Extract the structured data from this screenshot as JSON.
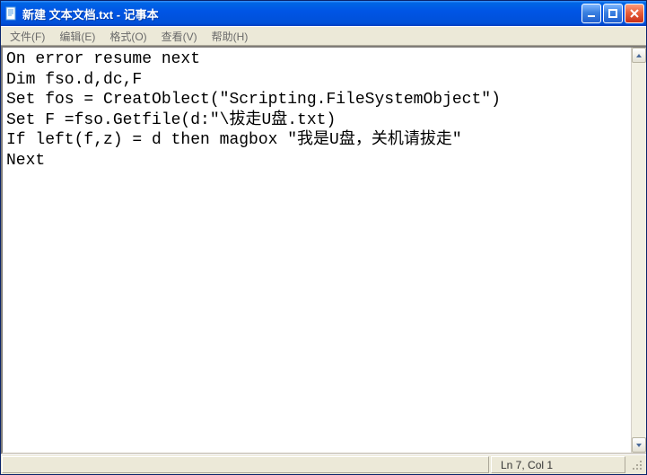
{
  "window": {
    "title": "新建 文本文档.txt - 记事本"
  },
  "menu": {
    "file": "文件(F)",
    "edit": "编辑(E)",
    "format": "格式(O)",
    "view": "查看(V)",
    "help": "帮助(H)"
  },
  "content": "On error resume next\nDim fso.d,dc,F\nSet fos = CreatOblect(\"Scripting.FileSystemObject\")\nSet F =fso.Getfile(d:\"\\拔走U盘.txt)\nIf left(f,z) = d then magbox \"我是U盘，关机请拔走\"\nNext",
  "status": {
    "position": "Ln 7, Col 1"
  }
}
